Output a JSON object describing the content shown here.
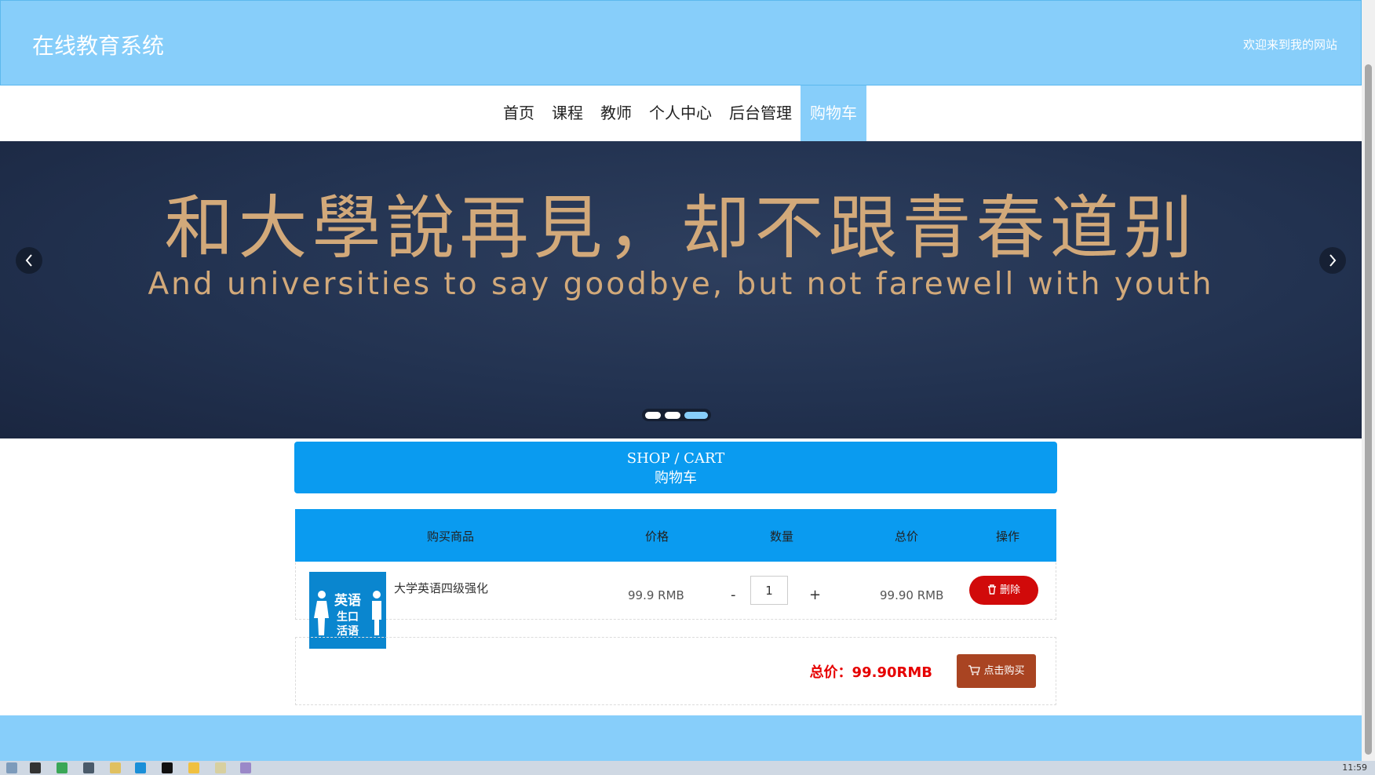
{
  "header": {
    "title": "在线教育系统",
    "welcome": "欢迎来到我的网站"
  },
  "nav": {
    "items": [
      "首页",
      "课程",
      "教师",
      "个人中心",
      "后台管理",
      "购物车"
    ],
    "active": "购物车"
  },
  "carousel": {
    "title": "和大學說再見，却不跟青春道别",
    "subtitle": "And universities to say goodbye, but not farewell with youth",
    "prev_icon": "chevron-left-icon",
    "next_icon": "chevron-right-icon",
    "slides": 3,
    "active_slide": 3
  },
  "cart_banner": {
    "en": "SHOP / CART",
    "cn": "购物车"
  },
  "table": {
    "headers": [
      "购买商品",
      "价格",
      "数量",
      "总价",
      "操作"
    ],
    "rows": [
      {
        "product": "大学英语四级强化",
        "thumb_text": [
          "英语",
          "生口",
          "活语"
        ],
        "price": "99.9 RMB",
        "qty_minus": "-",
        "qty": "1",
        "qty_plus": "+",
        "total": "99.90 RMB",
        "delete_label": "删除",
        "delete_icon": "trash-icon"
      }
    ]
  },
  "summary": {
    "total_label": "总价：99.90RMB",
    "buy_label": "点击购买",
    "buy_icon": "cart-icon"
  },
  "taskbar": {
    "clock": "11:59"
  },
  "colors": {
    "header": "#87cefa",
    "primary": "#0a9bf0",
    "danger": "#d10a0a",
    "buy": "#a94422"
  }
}
